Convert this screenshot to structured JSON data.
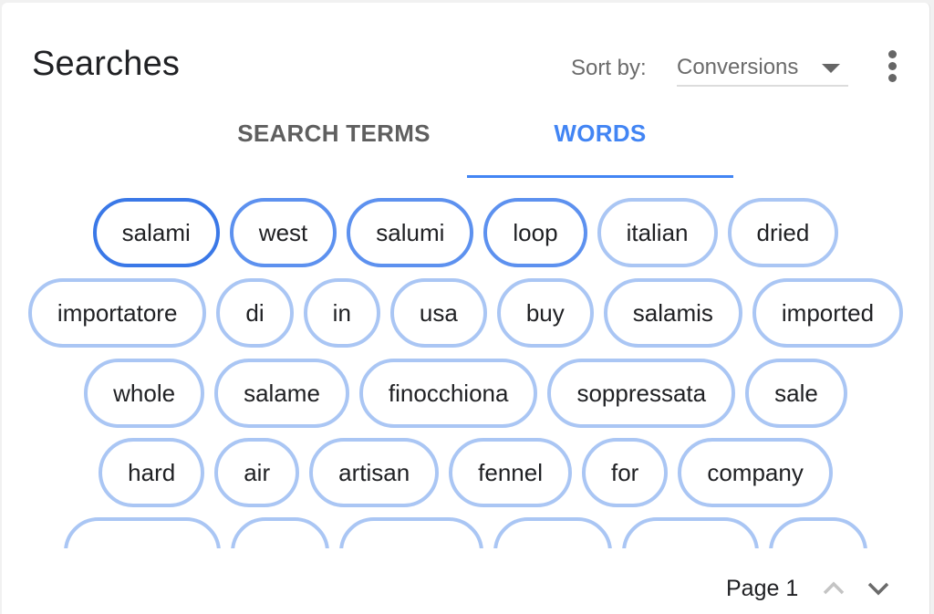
{
  "header": {
    "title": "Searches",
    "sort_label": "Sort by:",
    "sort_value": "Conversions",
    "more_menu_icon": "kebab-vertical-icon"
  },
  "tabs": [
    {
      "label": "SEARCH TERMS",
      "active": false
    },
    {
      "label": "WORDS",
      "active": true
    }
  ],
  "colors": {
    "accent": "#4285f4",
    "pill_strong": "#3a78e7",
    "pill_medium": "#5d91ef",
    "pill_light": "#aac6f4"
  },
  "word_rows": [
    [
      {
        "word": "salami",
        "level": 1
      },
      {
        "word": "west",
        "level": 2
      },
      {
        "word": "salumi",
        "level": 2
      },
      {
        "word": "loop",
        "level": 2
      },
      {
        "word": "italian",
        "level": 3
      },
      {
        "word": "dried",
        "level": 3
      }
    ],
    [
      {
        "word": "importatore",
        "level": 3
      },
      {
        "word": "di",
        "level": 3
      },
      {
        "word": "in",
        "level": 3
      },
      {
        "word": "usa",
        "level": 3
      },
      {
        "word": "buy",
        "level": 3
      },
      {
        "word": "salamis",
        "level": 3
      },
      {
        "word": "imported",
        "level": 3
      }
    ],
    [
      {
        "word": "whole",
        "level": 3
      },
      {
        "word": "salame",
        "level": 3
      },
      {
        "word": "finocchiona",
        "level": 3
      },
      {
        "word": "soppressata",
        "level": 3
      },
      {
        "word": "sale",
        "level": 3
      }
    ],
    [
      {
        "word": "hard",
        "level": 3
      },
      {
        "word": "air",
        "level": 3
      },
      {
        "word": "artisan",
        "level": 3
      },
      {
        "word": "fennel",
        "level": 3
      },
      {
        "word": "for",
        "level": 3
      },
      {
        "word": "company",
        "level": 3
      }
    ],
    [
      {
        "word": "",
        "level": 3
      },
      {
        "word": "",
        "level": 3
      },
      {
        "word": "",
        "level": 3
      },
      {
        "word": "",
        "level": 3
      },
      {
        "word": "",
        "level": 3
      },
      {
        "word": "",
        "level": 3
      }
    ]
  ],
  "pagination": {
    "page_label": "Page 1",
    "prev_icon": "chevron-up-icon",
    "next_icon": "chevron-down-icon",
    "prev_enabled": false,
    "next_enabled": true
  }
}
